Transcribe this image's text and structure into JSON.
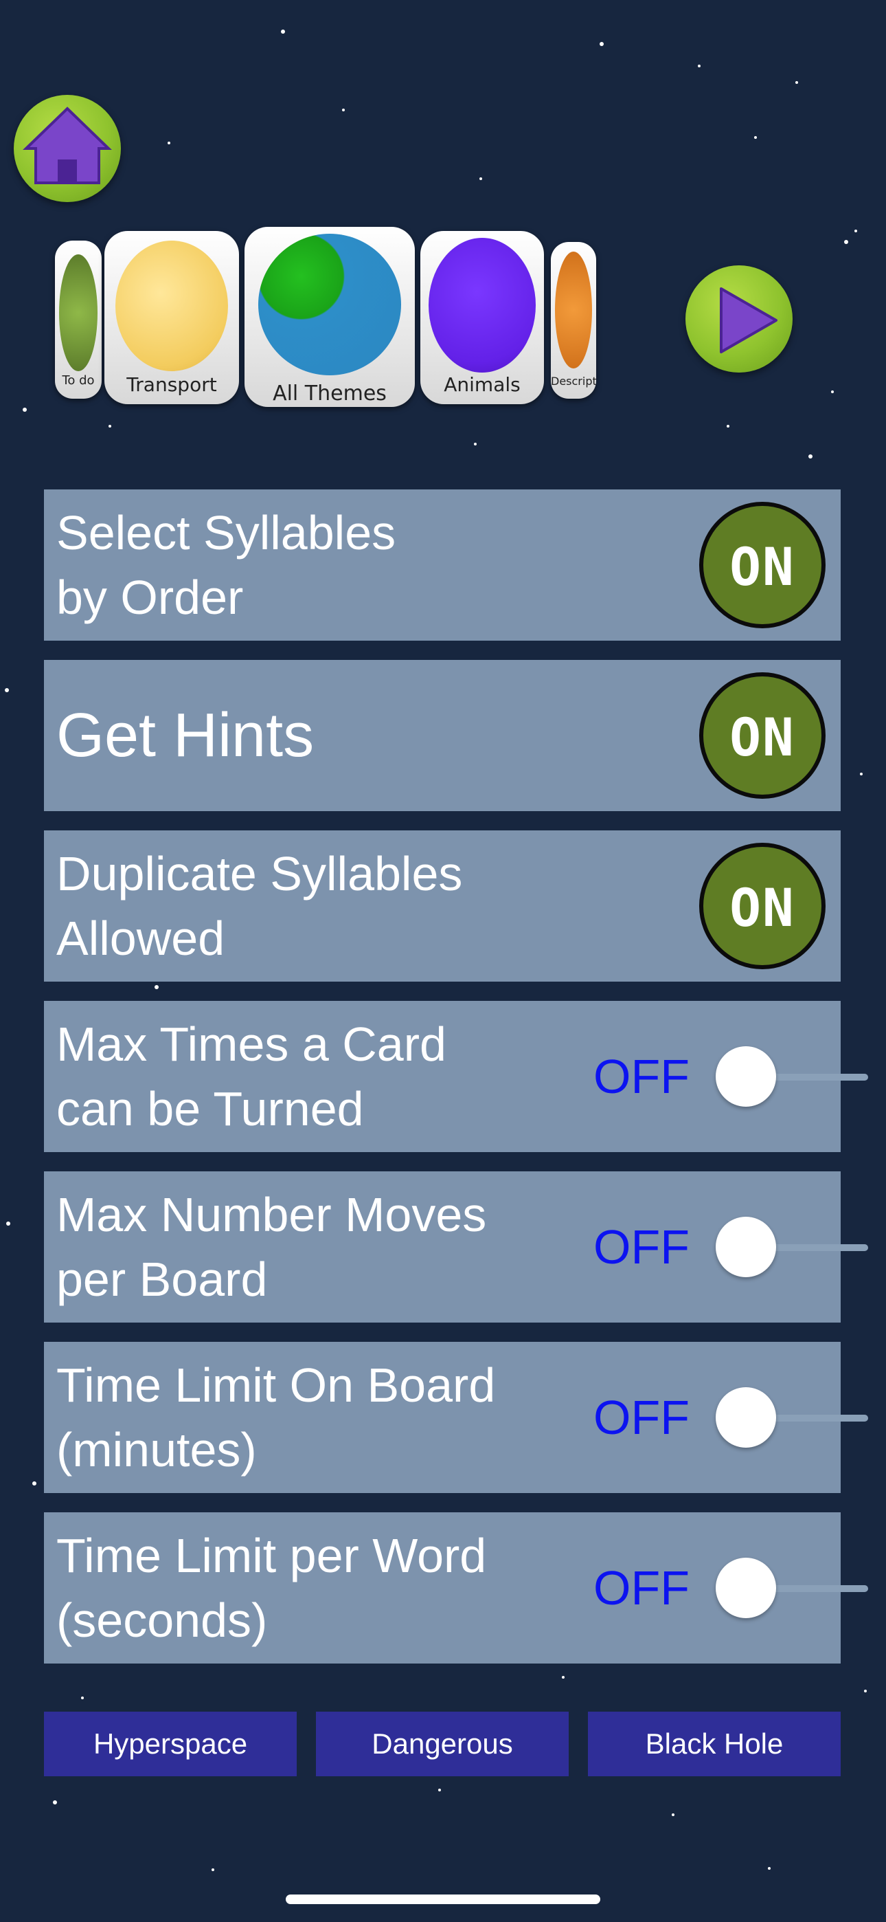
{
  "icons": {
    "home": "home-icon",
    "play": "play-icon"
  },
  "colors": {
    "background": "#17263f",
    "row_background": "#7d93ad",
    "on_button": "#5f7d24",
    "off_text": "#0c13f0",
    "level_button": "#2f2e98",
    "green_button": "#8fc32e",
    "purple_icon": "#7a45c9"
  },
  "carousel": {
    "themes": [
      {
        "label": "To do"
      },
      {
        "label": "Transport"
      },
      {
        "label": "All Themes"
      },
      {
        "label": "Animals"
      },
      {
        "label": "Description"
      }
    ]
  },
  "settings": [
    {
      "label": "Select Syllables\nby Order",
      "state": "ON",
      "control": "button"
    },
    {
      "label": "Get Hints",
      "state": "ON",
      "control": "button"
    },
    {
      "label": "Duplicate Syllables\nAllowed",
      "state": "ON",
      "control": "button"
    },
    {
      "label": "Max Times a Card\ncan be Turned",
      "state": "OFF",
      "control": "toggle"
    },
    {
      "label": "Max Number Moves\nper Board",
      "state": "OFF",
      "control": "toggle"
    },
    {
      "label": "Time Limit On Board\n(minutes)",
      "state": "OFF",
      "control": "toggle"
    },
    {
      "label": "Time Limit per Word\n(seconds)",
      "state": "OFF",
      "control": "toggle"
    }
  ],
  "levels": [
    {
      "label": "Hyperspace"
    },
    {
      "label": "Dangerous"
    },
    {
      "label": "Black Hole"
    }
  ]
}
